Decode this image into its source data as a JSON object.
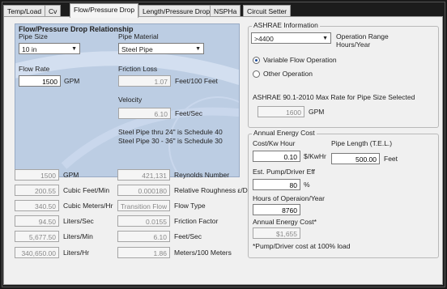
{
  "tabs": [
    "Temp/Load",
    "Cv",
    "Flow/Pressure Drop",
    "Length/Pressure Drop",
    "NSPHa",
    "Circuit Setter"
  ],
  "flow": {
    "title": "Flow/Pressure Drop Relationship",
    "pipe_size_label": "Pipe Size",
    "pipe_size_value": "10 in",
    "pipe_material_label": "Pipe Material",
    "pipe_material_value": "Steel Pipe",
    "flow_rate_label": "Flow Rate",
    "flow_rate_value": "1500",
    "flow_rate_unit": "GPM",
    "friction_loss_label": "Friction Loss",
    "friction_loss_value": "1.07",
    "friction_loss_unit": "Feet/100 Feet",
    "velocity_label": "Velocity",
    "velocity_value": "6.10",
    "velocity_unit": "Feet/Sec",
    "note_line1": "Steel Pipe thru 24\" is Schedule 40",
    "note_line2": "Steel Pipe 30 - 36\" is Schedule 30"
  },
  "results_left": [
    {
      "value": "1500",
      "unit": "GPM"
    },
    {
      "value": "200.55",
      "unit": "Cubic Feet/Min"
    },
    {
      "value": "340.50",
      "unit": "Cubic Meters/Hr"
    },
    {
      "value": "94.50",
      "unit": "Liters/Sec"
    },
    {
      "value": "5,677.50",
      "unit": "Liters/Min"
    },
    {
      "value": "340,650.00",
      "unit": "Liters/Hr"
    }
  ],
  "results_right": [
    {
      "value": "421,131",
      "unit": "Reynolds Number"
    },
    {
      "value": "0.000180",
      "unit": "Relative Roughness ε/D"
    },
    {
      "value": "Transition Flow",
      "unit": "Flow Type"
    },
    {
      "value": "0.0155",
      "unit": "Friction Factor"
    },
    {
      "value": "6.10",
      "unit": "Feet/Sec"
    },
    {
      "value": "1.86",
      "unit": "Meters/100 Meters"
    }
  ],
  "ashrae": {
    "title": "ASHRAE Information",
    "range_value": ">4400",
    "range_label_line1": "Operation Range",
    "range_label_line2": "Hours/Year",
    "variable_flow": "Variable Flow Operation",
    "other_operation": "Other Operation",
    "max_rate_label": "ASHRAE 90.1-2010 Max Rate for Pipe Size Selected",
    "max_rate_value": "1600",
    "max_rate_unit": "GPM"
  },
  "energy": {
    "title": "Annual Energy Cost",
    "cost_label": "Cost/Kw Hour",
    "cost_value": "0.10",
    "cost_unit": "$/KwHr",
    "pipe_length_label": "Pipe Length (T.E.L.)",
    "pipe_length_value": "500.00",
    "pipe_length_unit": "Feet",
    "eff_label": "Est. Pump/Driver Eff",
    "eff_value": "80",
    "eff_unit": "%",
    "hours_label": "Hours of Operaion/Year",
    "hours_value": "8760",
    "annual_label": "Annual Energy Cost*",
    "annual_value": "$1,655",
    "footnote": "*Pump/Driver cost at 100% load"
  }
}
